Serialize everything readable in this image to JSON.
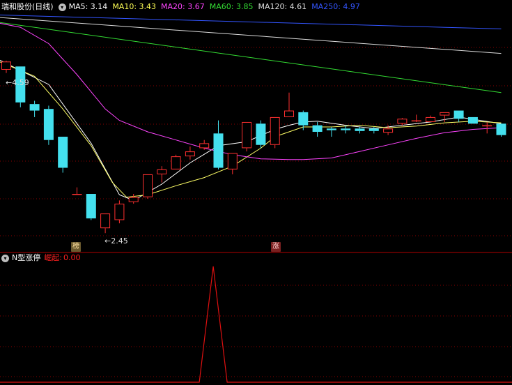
{
  "header": {
    "stock": "瑞和股份(日线)",
    "ma": [
      {
        "label": "MA5:",
        "value": "3.14",
        "color": "#ffffff"
      },
      {
        "label": "MA10:",
        "value": "3.43",
        "color": "#ffff55"
      },
      {
        "label": "MA20:",
        "value": "3.67",
        "color": "#ff44ff"
      },
      {
        "label": "MA60:",
        "value": "3.85",
        "color": "#33dd33"
      },
      {
        "label": "MA120:",
        "value": "4.61",
        "color": "#dddddd"
      },
      {
        "label": "MA250:",
        "value": "4.97",
        "color": "#3355ff"
      }
    ]
  },
  "indicator": {
    "name": "N型涨停",
    "label": "崛起:",
    "value": "0.00",
    "color": "#ff2020"
  },
  "annotations": {
    "high": "←4.59",
    "low": "←2.45"
  },
  "badges": {
    "bang": "榜",
    "zhang": "涨"
  },
  "colors": {
    "up": "#ff3030",
    "down": "#44e0ee",
    "grid": "#8b0000",
    "signal": "#e01010"
  },
  "chart_data": {
    "type": "candlestick",
    "ylim": [
      2.26,
      5.18
    ],
    "candles": [
      {
        "o": 4.48,
        "c": 4.58,
        "h": 4.59,
        "l": 4.44
      },
      {
        "o": 4.52,
        "c": 4.08,
        "h": 4.52,
        "l": 4.02
      },
      {
        "o": 4.06,
        "c": 3.98,
        "h": 4.1,
        "l": 3.9
      },
      {
        "o": 4.0,
        "c": 3.62,
        "h": 4.04,
        "l": 3.56
      },
      {
        "o": 3.66,
        "c": 3.28,
        "h": 3.66,
        "l": 3.22
      },
      {
        "o": 2.96,
        "c": 2.96,
        "h": 3.04,
        "l": 2.96
      },
      {
        "o": 2.96,
        "c": 2.66,
        "h": 2.96,
        "l": 2.64
      },
      {
        "o": 2.54,
        "c": 2.72,
        "h": 2.72,
        "l": 2.48
      },
      {
        "o": 2.64,
        "c": 2.84,
        "h": 2.88,
        "l": 2.6
      },
      {
        "o": 2.86,
        "c": 2.92,
        "h": 2.96,
        "l": 2.84
      },
      {
        "o": 2.92,
        "c": 3.2,
        "h": 3.2,
        "l": 2.9
      },
      {
        "o": 3.2,
        "c": 3.26,
        "h": 3.3,
        "l": 3.1
      },
      {
        "o": 3.26,
        "c": 3.42,
        "h": 3.44,
        "l": 3.26
      },
      {
        "o": 3.42,
        "c": 3.48,
        "h": 3.54,
        "l": 3.38
      },
      {
        "o": 3.52,
        "c": 3.58,
        "h": 3.62,
        "l": 3.5
      },
      {
        "o": 3.7,
        "c": 3.28,
        "h": 3.86,
        "l": 3.26
      },
      {
        "o": 3.26,
        "c": 3.46,
        "h": 3.46,
        "l": 3.2
      },
      {
        "o": 3.52,
        "c": 3.84,
        "h": 3.84,
        "l": 3.48
      },
      {
        "o": 3.82,
        "c": 3.56,
        "h": 3.86,
        "l": 3.52
      },
      {
        "o": 3.56,
        "c": 3.9,
        "h": 3.9,
        "l": 3.52
      },
      {
        "o": 3.9,
        "c": 3.98,
        "h": 4.2,
        "l": 3.9
      },
      {
        "o": 3.96,
        "c": 3.8,
        "h": 3.98,
        "l": 3.74
      },
      {
        "o": 3.8,
        "c": 3.72,
        "h": 3.84,
        "l": 3.66
      },
      {
        "o": 3.76,
        "c": 3.74,
        "h": 3.78,
        "l": 3.66
      },
      {
        "o": 3.76,
        "c": 3.74,
        "h": 3.8,
        "l": 3.7
      },
      {
        "o": 3.76,
        "c": 3.73,
        "h": 3.78,
        "l": 3.7
      },
      {
        "o": 3.76,
        "c": 3.73,
        "h": 3.78,
        "l": 3.7
      },
      {
        "o": 3.71,
        "c": 3.76,
        "h": 3.8,
        "l": 3.68
      },
      {
        "o": 3.82,
        "c": 3.88,
        "h": 3.89,
        "l": 3.8
      },
      {
        "o": 3.86,
        "c": 3.86,
        "h": 3.93,
        "l": 3.84
      },
      {
        "o": 3.84,
        "c": 3.9,
        "h": 3.92,
        "l": 3.84
      },
      {
        "o": 3.92,
        "c": 3.96,
        "h": 3.96,
        "l": 3.84
      },
      {
        "o": 3.98,
        "c": 3.88,
        "h": 3.98,
        "l": 3.84
      },
      {
        "o": 3.9,
        "c": 3.82,
        "h": 3.9,
        "l": 3.82
      },
      {
        "o": 3.8,
        "c": 3.8,
        "h": 3.84,
        "l": 3.7
      },
      {
        "o": 3.82,
        "c": 3.68,
        "h": 3.82,
        "l": 3.66
      }
    ],
    "ma_lines": [
      {
        "name": "MA5",
        "color": "#ffffff",
        "points": [
          [
            -0.5,
            4.6
          ],
          [
            3,
            4.3
          ],
          [
            6,
            3.58
          ],
          [
            8,
            2.95
          ],
          [
            9,
            2.88
          ],
          [
            11,
            3.08
          ],
          [
            13,
            3.34
          ],
          [
            15,
            3.55
          ],
          [
            17,
            3.6
          ],
          [
            19,
            3.75
          ],
          [
            20,
            3.8
          ],
          [
            21,
            3.84
          ],
          [
            22,
            3.85
          ],
          [
            24,
            3.8
          ],
          [
            26,
            3.76
          ],
          [
            28,
            3.8
          ],
          [
            30,
            3.84
          ],
          [
            32,
            3.9
          ],
          [
            35,
            3.82
          ]
        ]
      },
      {
        "name": "MA10",
        "color": "#ffff66",
        "points": [
          [
            -0.5,
            4.58
          ],
          [
            2,
            4.4
          ],
          [
            4,
            4.0
          ],
          [
            6,
            3.55
          ],
          [
            7.5,
            3.1
          ],
          [
            8.5,
            2.92
          ],
          [
            10,
            2.95
          ],
          [
            12,
            3.06
          ],
          [
            14,
            3.16
          ],
          [
            16,
            3.3
          ],
          [
            18,
            3.52
          ],
          [
            19,
            3.66
          ],
          [
            21,
            3.78
          ],
          [
            23,
            3.78
          ],
          [
            25,
            3.8
          ],
          [
            27,
            3.77
          ],
          [
            29,
            3.79
          ],
          [
            31,
            3.83
          ],
          [
            33,
            3.85
          ],
          [
            35,
            3.83
          ]
        ]
      },
      {
        "name": "MA20",
        "color": "#ff44ff",
        "points": [
          [
            -0.5,
            5.05
          ],
          [
            1,
            5.0
          ],
          [
            3,
            4.8
          ],
          [
            5,
            4.42
          ],
          [
            7,
            4.0
          ],
          [
            8,
            3.86
          ],
          [
            10,
            3.72
          ],
          [
            12,
            3.62
          ],
          [
            14,
            3.52
          ],
          [
            16,
            3.44
          ],
          [
            18,
            3.39
          ],
          [
            20,
            3.38
          ],
          [
            21,
            3.38
          ],
          [
            23,
            3.4
          ],
          [
            25,
            3.48
          ],
          [
            27,
            3.56
          ],
          [
            29,
            3.64
          ],
          [
            31,
            3.71
          ],
          [
            33,
            3.75
          ],
          [
            35,
            3.77
          ]
        ]
      },
      {
        "name": "MA60",
        "color": "#33dd33",
        "points": [
          [
            -0.5,
            5.06
          ],
          [
            35,
            4.2
          ]
        ]
      },
      {
        "name": "MA120",
        "color": "#dddddd",
        "points": [
          [
            -0.5,
            5.12
          ],
          [
            35,
            4.68
          ]
        ]
      },
      {
        "name": "MA250",
        "color": "#3355ff",
        "points": [
          [
            -0.5,
            5.15
          ],
          [
            35,
            4.98
          ]
        ]
      }
    ],
    "signal": {
      "spike_index": 17,
      "value": 1
    }
  }
}
